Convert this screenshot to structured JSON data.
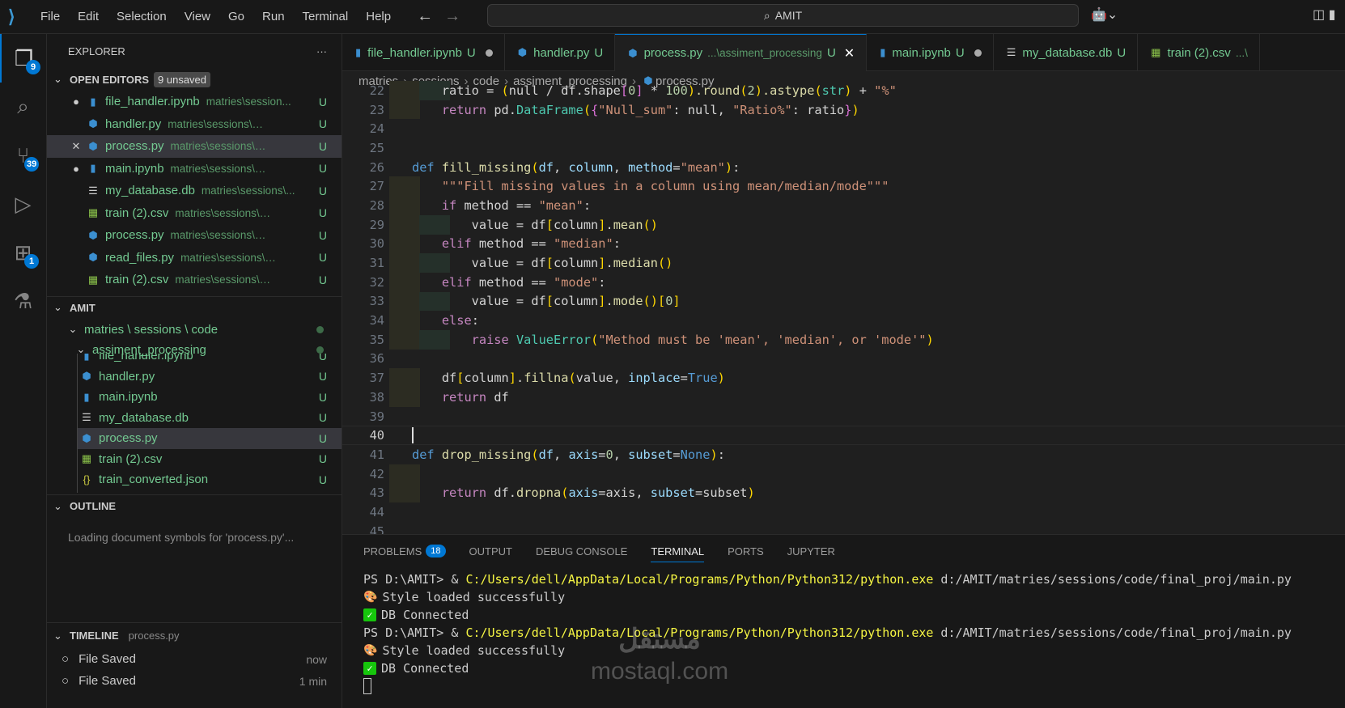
{
  "titlebar": {
    "menu": [
      "File",
      "Edit",
      "Selection",
      "View",
      "Go",
      "Run",
      "Terminal",
      "Help"
    ],
    "search": "AMIT"
  },
  "activity": {
    "explorer_badge": "9",
    "scm_badge": "39",
    "extensions_badge": "1"
  },
  "explorer": {
    "title": "EXPLORER",
    "more": "···",
    "open_editors": {
      "label": "OPEN EDITORS",
      "unsaved": "9 unsaved",
      "items": [
        {
          "name": "file_handler.ipynb",
          "desc": "matries\\session...",
          "status": "U",
          "lead": "●",
          "icon": "notebook"
        },
        {
          "name": "handler.py",
          "desc": "matries\\sessions\\code\\...",
          "status": "U",
          "lead": "",
          "icon": "python"
        },
        {
          "name": "process.py",
          "desc": "matries\\sessions\\code\\...",
          "status": "U",
          "lead": "✕",
          "icon": "python"
        },
        {
          "name": "main.ipynb",
          "desc": "matries\\sessions\\code\\...",
          "status": "U",
          "lead": "●",
          "icon": "notebook"
        },
        {
          "name": "my_database.db",
          "desc": "matries\\sessions\\...",
          "status": "U",
          "lead": "",
          "icon": "text"
        },
        {
          "name": "train (2).csv",
          "desc": "matries\\sessions\\code...",
          "status": "U",
          "lead": "",
          "icon": "csv"
        },
        {
          "name": "process.py",
          "desc": "matries\\sessions\\code\\...",
          "status": "U",
          "lead": "",
          "icon": "python"
        },
        {
          "name": "read_files.py",
          "desc": "matries\\sessions\\cod...",
          "status": "U",
          "lead": "",
          "icon": "python"
        },
        {
          "name": "train (2).csv",
          "desc": "matries\\sessions\\code...",
          "status": "U",
          "lead": "",
          "icon": "csv"
        }
      ]
    },
    "folder": {
      "label": "AMIT",
      "path": "matries \\ sessions \\ code",
      "sub": "assiment_processing",
      "files": [
        {
          "name": "file_handler.ipynb",
          "status": "U",
          "icon": "notebook"
        },
        {
          "name": "handler.py",
          "status": "U",
          "icon": "python"
        },
        {
          "name": "main.ipynb",
          "status": "U",
          "icon": "notebook"
        },
        {
          "name": "my_database.db",
          "status": "U",
          "icon": "text"
        },
        {
          "name": "process.py",
          "status": "U",
          "icon": "python"
        },
        {
          "name": "train (2).csv",
          "status": "U",
          "icon": "csv"
        },
        {
          "name": "train_converted.json",
          "status": "U",
          "icon": "json"
        }
      ]
    },
    "outline": {
      "label": "OUTLINE",
      "message": "Loading document symbols for 'process.py'..."
    },
    "timeline": {
      "label": "TIMELINE",
      "file": "process.py",
      "items": [
        {
          "label": "File Saved",
          "time": "now"
        },
        {
          "label": "File Saved",
          "time": "1 min"
        }
      ]
    }
  },
  "tabs": [
    {
      "name": "file_handler.ipynb",
      "status": "U",
      "icon": "notebook",
      "dirty": true
    },
    {
      "name": "handler.py",
      "status": "U",
      "icon": "python"
    },
    {
      "name": "process.py",
      "path": "...\\assiment_processing",
      "status": "U",
      "icon": "python",
      "active": true
    },
    {
      "name": "main.ipynb",
      "status": "U",
      "icon": "notebook",
      "dirty": true
    },
    {
      "name": "my_database.db",
      "status": "U",
      "icon": "text"
    },
    {
      "name": "train (2).csv",
      "path": "...\\",
      "icon": "csv"
    }
  ],
  "breadcrumb": [
    "matries",
    "sessions",
    "code",
    "assiment_processing",
    "process.py"
  ],
  "code": {
    "current_line": 40,
    "lines": [
      {
        "n": "22",
        "g": 2,
        "t": [
          [
            "    ratio = ",
            "pl"
          ],
          [
            "(",
            "b1"
          ],
          [
            "null / df.shape",
            "pl"
          ],
          [
            "[",
            "b2"
          ],
          [
            "0",
            "numl"
          ],
          [
            "]",
            "b2"
          ],
          [
            " * ",
            "pl"
          ],
          [
            "100",
            "numl"
          ],
          [
            ")",
            "b1"
          ],
          [
            ".round",
            "fn"
          ],
          [
            "(",
            "b1"
          ],
          [
            "2",
            "numl"
          ],
          [
            ")",
            "b1"
          ],
          [
            ".astype",
            "fn"
          ],
          [
            "(",
            "b1"
          ],
          [
            "str",
            "cls"
          ],
          [
            ")",
            "b1"
          ],
          [
            " + ",
            "pl"
          ],
          [
            "\"%\"",
            "str"
          ]
        ]
      },
      {
        "n": "23",
        "g": 1,
        "t": [
          [
            "    return",
            "ctl"
          ],
          [
            " pd.",
            "pl"
          ],
          [
            "DataFrame",
            "cls"
          ],
          [
            "(",
            "b1"
          ],
          [
            "{",
            "b2"
          ],
          [
            "\"Null_sum\"",
            "str"
          ],
          [
            ": null, ",
            "pl"
          ],
          [
            "\"Ratio%\"",
            "str"
          ],
          [
            ": ratio",
            "pl"
          ],
          [
            "}",
            "b2"
          ],
          [
            ")",
            "b1"
          ]
        ]
      },
      {
        "n": "24",
        "g": 0,
        "t": []
      },
      {
        "n": "25",
        "g": 0,
        "t": []
      },
      {
        "n": "26",
        "g": 0,
        "t": [
          [
            "def",
            "kw"
          ],
          [
            " ",
            "pl"
          ],
          [
            "fill_missing",
            "fn"
          ],
          [
            "(",
            "b1"
          ],
          [
            "df",
            "par"
          ],
          [
            ", ",
            "pl"
          ],
          [
            "column",
            "par"
          ],
          [
            ", ",
            "pl"
          ],
          [
            "method",
            "par"
          ],
          [
            "=",
            "pl"
          ],
          [
            "\"mean\"",
            "str"
          ],
          [
            ")",
            "b1"
          ],
          [
            ":",
            "pl"
          ]
        ]
      },
      {
        "n": "27",
        "g": 1,
        "t": [
          [
            "    \"\"\"Fill missing values in a column using mean/median/mode\"\"\"",
            "str"
          ]
        ]
      },
      {
        "n": "28",
        "g": 1,
        "t": [
          [
            "    if",
            "ctl"
          ],
          [
            " method == ",
            "pl"
          ],
          [
            "\"mean\"",
            "str"
          ],
          [
            ":",
            "pl"
          ]
        ]
      },
      {
        "n": "29",
        "g": 2,
        "t": [
          [
            "        value = df",
            "pl"
          ],
          [
            "[",
            "b1"
          ],
          [
            "column",
            "pl"
          ],
          [
            "]",
            "b1"
          ],
          [
            ".",
            "pl"
          ],
          [
            "mean",
            "fn"
          ],
          [
            "()",
            "b1"
          ]
        ]
      },
      {
        "n": "30",
        "g": 1,
        "t": [
          [
            "    elif",
            "ctl"
          ],
          [
            " method == ",
            "pl"
          ],
          [
            "\"median\"",
            "str"
          ],
          [
            ":",
            "pl"
          ]
        ]
      },
      {
        "n": "31",
        "g": 2,
        "t": [
          [
            "        value = df",
            "pl"
          ],
          [
            "[",
            "b1"
          ],
          [
            "column",
            "pl"
          ],
          [
            "]",
            "b1"
          ],
          [
            ".",
            "pl"
          ],
          [
            "median",
            "fn"
          ],
          [
            "()",
            "b1"
          ]
        ]
      },
      {
        "n": "32",
        "g": 1,
        "t": [
          [
            "    elif",
            "ctl"
          ],
          [
            " method == ",
            "pl"
          ],
          [
            "\"mode\"",
            "str"
          ],
          [
            ":",
            "pl"
          ]
        ]
      },
      {
        "n": "33",
        "g": 2,
        "t": [
          [
            "        value = df",
            "pl"
          ],
          [
            "[",
            "b1"
          ],
          [
            "column",
            "pl"
          ],
          [
            "]",
            "b1"
          ],
          [
            ".",
            "pl"
          ],
          [
            "mode",
            "fn"
          ],
          [
            "()",
            "b1"
          ],
          [
            "[",
            "b1"
          ],
          [
            "0",
            "numl"
          ],
          [
            "]",
            "b1"
          ]
        ]
      },
      {
        "n": "34",
        "g": 1,
        "t": [
          [
            "    else",
            "ctl"
          ],
          [
            ":",
            "pl"
          ]
        ]
      },
      {
        "n": "35",
        "g": 2,
        "t": [
          [
            "        raise",
            "ctl"
          ],
          [
            " ",
            "pl"
          ],
          [
            "ValueError",
            "cls"
          ],
          [
            "(",
            "b1"
          ],
          [
            "\"Method must be 'mean', 'median', or 'mode'\"",
            "str"
          ],
          [
            ")",
            "b1"
          ]
        ]
      },
      {
        "n": "36",
        "g": 0,
        "t": []
      },
      {
        "n": "37",
        "g": 1,
        "t": [
          [
            "    df",
            "pl"
          ],
          [
            "[",
            "b1"
          ],
          [
            "column",
            "pl"
          ],
          [
            "]",
            "b1"
          ],
          [
            ".",
            "pl"
          ],
          [
            "fillna",
            "fn"
          ],
          [
            "(",
            "b1"
          ],
          [
            "value, ",
            "pl"
          ],
          [
            "inplace",
            "par"
          ],
          [
            "=",
            "pl"
          ],
          [
            "True",
            "kw"
          ],
          [
            ")",
            "b1"
          ]
        ]
      },
      {
        "n": "38",
        "g": 1,
        "t": [
          [
            "    return",
            "ctl"
          ],
          [
            " df",
            "pl"
          ]
        ]
      },
      {
        "n": "39",
        "g": 0,
        "t": []
      },
      {
        "n": "40",
        "g": 0,
        "t": []
      },
      {
        "n": "41",
        "g": 0,
        "t": [
          [
            "def",
            "kw"
          ],
          [
            " ",
            "pl"
          ],
          [
            "drop_missing",
            "fn"
          ],
          [
            "(",
            "b1"
          ],
          [
            "df",
            "par"
          ],
          [
            ", ",
            "pl"
          ],
          [
            "axis",
            "par"
          ],
          [
            "=",
            "pl"
          ],
          [
            "0",
            "numl"
          ],
          [
            ", ",
            "pl"
          ],
          [
            "subset",
            "par"
          ],
          [
            "=",
            "pl"
          ],
          [
            "None",
            "kw"
          ],
          [
            ")",
            "b1"
          ],
          [
            ":",
            "pl"
          ]
        ]
      },
      {
        "n": "42",
        "g": 1,
        "t": []
      },
      {
        "n": "43",
        "g": 1,
        "t": [
          [
            "    return",
            "ctl"
          ],
          [
            " df.",
            "pl"
          ],
          [
            "dropna",
            "fn"
          ],
          [
            "(",
            "b1"
          ],
          [
            "axis",
            "par"
          ],
          [
            "=axis, ",
            "pl"
          ],
          [
            "subset",
            "par"
          ],
          [
            "=subset",
            "pl"
          ],
          [
            ")",
            "b1"
          ]
        ]
      },
      {
        "n": "44",
        "g": 0,
        "t": []
      },
      {
        "n": "45",
        "g": 0,
        "t": []
      }
    ]
  },
  "panel": {
    "tabs": [
      "PROBLEMS",
      "OUTPUT",
      "DEBUG CONSOLE",
      "TERMINAL",
      "PORTS",
      "JUPYTER"
    ],
    "problems_count": "18",
    "active": "TERMINAL",
    "terminal": [
      {
        "type": "cmd",
        "prompt": "PS D:\\AMIT> & ",
        "exe": "C:/Users/dell/AppData/Local/Programs/Python/Python312/python.exe",
        "arg": " d:/AMIT/matries/sessions/code/final_proj/main.py"
      },
      {
        "type": "style",
        "text": "Style loaded successfully"
      },
      {
        "type": "ok",
        "text": "DB Connected"
      },
      {
        "type": "cmd",
        "prompt": "PS D:\\AMIT> & ",
        "exe": "C:/Users/dell/AppData/Local/Programs/Python/Python312/python.exe",
        "arg": " d:/AMIT/matries/sessions/code/final_proj/main.py"
      },
      {
        "type": "style",
        "text": "Style loaded successfully"
      },
      {
        "type": "ok",
        "text": "DB Connected"
      }
    ]
  },
  "watermark": {
    "arabic": "مستقل",
    "latin": "mostaql.com"
  }
}
